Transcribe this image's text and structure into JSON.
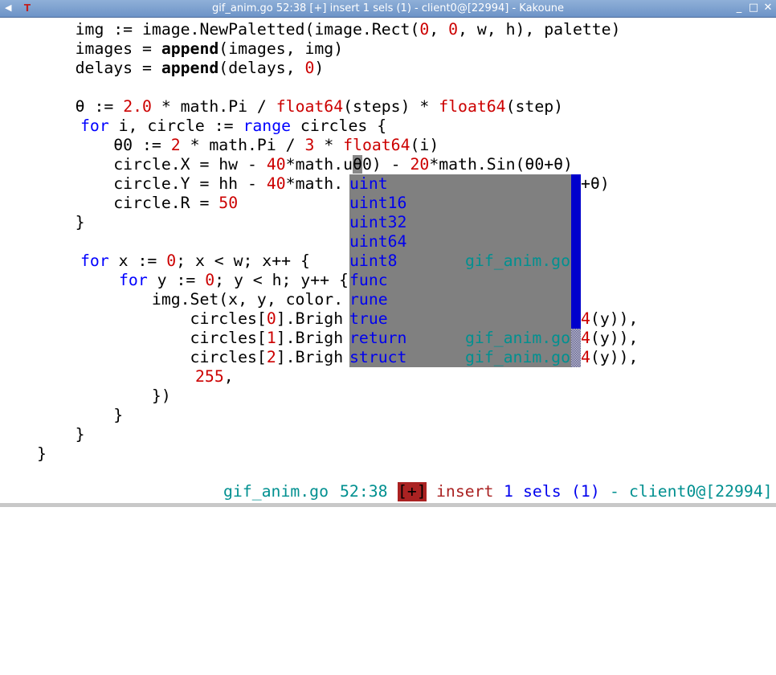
{
  "window": {
    "title": "gif_anim.go 52:38 [+] insert 1 sels (1) - client0@[22994] - Kakoune",
    "menu_icon": "window-menu-icon",
    "app_icon": "kakoune-app-icon",
    "app_icon_glyph": "T",
    "buttons": {
      "minimize": "_",
      "maximize": "□",
      "close": "✕"
    }
  },
  "code": {
    "l1": {
      "a": "    img := image.NewPaletted(image.Rect(",
      "b": "0",
      "c": ", ",
      "d": "0",
      "e": ", w, h), palette)"
    },
    "l2": {
      "a": "    images = ",
      "b": "append",
      "c": "(images, img)"
    },
    "l3": {
      "a": "    delays = ",
      "b": "append",
      "c": "(delays, ",
      "d": "0",
      "e": ")"
    },
    "l5": {
      "a": "    θ := ",
      "b": "2.0",
      "c": " * math.Pi / ",
      "d": "float64",
      "e": "(steps) * ",
      "f": "float64",
      "g": "(step)"
    },
    "l6": {
      "a": "for",
      "b": " i, circle := ",
      "c": "range",
      "d": " circles {"
    },
    "l7": {
      "a": "        θ0 := ",
      "b": "2",
      "c": " * math.Pi / ",
      "d": "3",
      "e": " * ",
      "f": "float64",
      "g": "(i)"
    },
    "l8": {
      "a": "        circle.X = hw - ",
      "b": "40",
      "c": "*math.u",
      "d": "θ",
      "e": "0) - ",
      "f": "20",
      "g": "*math.Sin(θ0+θ)"
    },
    "l9": {
      "a": "        circle.Y = hh - ",
      "b": "40",
      "c": "*math.",
      "tail": "+θ)"
    },
    "l10": {
      "a": "        circle.R = ",
      "b": "50"
    },
    "l11": {
      "a": "    }"
    },
    "l13": {
      "a": "for",
      "b": " x := ",
      "c": "0",
      "d": "; x < w; x++ {"
    },
    "l14": {
      "a": "for",
      "b": " y := ",
      "c": "0",
      "d": "; y < h; y++ {"
    },
    "l15": {
      "a": "            img.Set(x, y, color."
    },
    "l16": {
      "a": "                circles[",
      "b": "0",
      "c": "].Brigh",
      "tail_a": "4",
      "tail_b": "(y)),"
    },
    "l17": {
      "a": "                circles[",
      "b": "1",
      "c": "].Brigh",
      "tail_a": "4",
      "tail_b": "(y)),"
    },
    "l18": {
      "a": "                circles[",
      "b": "2",
      "c": "].Brigh",
      "tail_a": "4",
      "tail_b": "(y)),"
    },
    "l19": {
      "a": "255",
      "b": ","
    },
    "l20": {
      "a": "            })"
    },
    "l21": {
      "a": "        }"
    },
    "l22": {
      "a": "    }"
    },
    "l23": {
      "a": "}"
    }
  },
  "completion": {
    "items": [
      {
        "name": "uint",
        "file": ""
      },
      {
        "name": "uint16",
        "file": ""
      },
      {
        "name": "uint32",
        "file": ""
      },
      {
        "name": "uint64",
        "file": ""
      },
      {
        "name": "uint8",
        "file": "gif_anim.go"
      },
      {
        "name": "func",
        "file": ""
      },
      {
        "name": "rune",
        "file": ""
      },
      {
        "name": "true",
        "file": ""
      },
      {
        "name": "return",
        "file": "gif_anim.go"
      },
      {
        "name": "struct",
        "file": "gif_anim.go"
      }
    ]
  },
  "status": {
    "file": "gif_anim.go",
    "position": "52:38",
    "modified": "[+]",
    "mode": "insert",
    "sels_count": "1",
    "sels_label": "sels",
    "sels_index": "(1)",
    "dash": "-",
    "client": "client0@[22994]"
  },
  "colors": {
    "keyword": "#0000ff",
    "number": "#cc0000",
    "menu_bg": "#808080",
    "menu_item": "#0000ee",
    "menu_file": "#009090",
    "scrollbar": "#0000cc"
  }
}
